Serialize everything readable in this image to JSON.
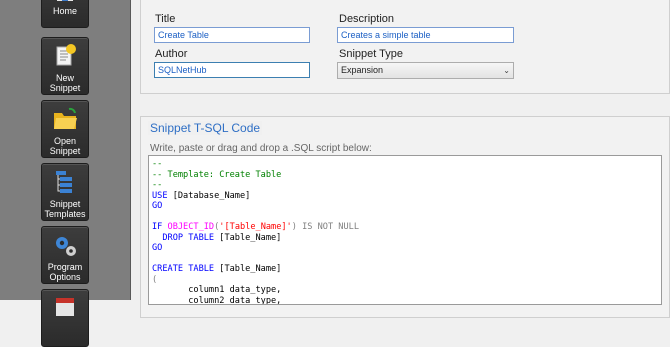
{
  "sidebar": {
    "items": [
      {
        "label": "Home",
        "icon": "home-icon"
      },
      {
        "label": "New\nSnippet",
        "icon": "new-snippet-icon"
      },
      {
        "label": "Open\nSnippet",
        "icon": "folder-icon"
      },
      {
        "label": "Snippet\nTemplates",
        "icon": "templates-icon"
      },
      {
        "label": "Program\nOptions",
        "icon": "gears-icon"
      },
      {
        "label": "",
        "icon": "calendar-icon"
      }
    ]
  },
  "details": {
    "title_label": "Title",
    "title_value": "Create Table",
    "description_label": "Description",
    "description_value": "Creates a simple table",
    "author_label": "Author",
    "author_value": "SQLNetHub",
    "snippet_type_label": "Snippet Type",
    "snippet_type_value": "Expansion"
  },
  "code": {
    "group_title": "Snippet T-SQL Code",
    "hint": "Write, paste or drag and drop a .SQL script below:",
    "lines": [
      [
        [
          "cm",
          "--"
        ]
      ],
      [
        [
          "cm",
          "-- Template: Create Table"
        ]
      ],
      [
        [
          "cm",
          "--"
        ]
      ],
      [
        [
          "kw",
          "USE "
        ],
        [
          "tx",
          "[Database_Name]"
        ]
      ],
      [
        [
          "kw",
          "GO"
        ]
      ],
      [
        [
          "tx",
          ""
        ]
      ],
      [
        [
          "kw",
          "IF "
        ],
        [
          "fn",
          "OBJECT_ID"
        ],
        [
          "gr",
          "("
        ],
        [
          "st",
          "'[Table_Name]'"
        ],
        [
          "gr",
          ") IS NOT NULL"
        ]
      ],
      [
        [
          "kw",
          "  DROP TABLE "
        ],
        [
          "tx",
          "[Table_Name]"
        ]
      ],
      [
        [
          "kw",
          "GO"
        ]
      ],
      [
        [
          "tx",
          ""
        ]
      ],
      [
        [
          "kw",
          "CREATE TABLE "
        ],
        [
          "tx",
          "[Table_Name]"
        ]
      ],
      [
        [
          "gr",
          "("
        ]
      ],
      [
        [
          "tx",
          "       column1 data_type,"
        ]
      ],
      [
        [
          "tx",
          "       column2 data_type,"
        ]
      ]
    ]
  }
}
